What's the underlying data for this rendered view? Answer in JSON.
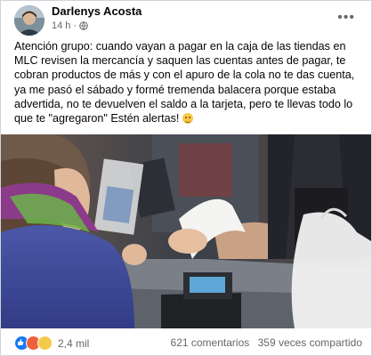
{
  "author": {
    "name": "Darlenys Acosta",
    "time": "14 h",
    "privacy_icon": "globe-icon"
  },
  "post": {
    "text": "Atención grupo: cuando vayan a pagar en la caja de las tiendas en MLC revisen la mercancía y saquen las cuentas antes de pagar, te cobran productos de más y con el apuro de la cola no te das cuenta, ya me pasó el sábado y formé tremenda balacera porque estaba advertida, no te devuelven el saldo a la tarjeta, pero te llevas todo lo que te \"agregaron\" Estén alertas!",
    "emoji": "grin-emoji"
  },
  "photo": {
    "description_icon": "photo"
  },
  "footer": {
    "reactions": [
      "like-icon",
      "angry-icon",
      "wow-icon"
    ],
    "reaction_count": "2,4 mil",
    "comments": "621 comentarios",
    "shares": "359 veces compartido"
  },
  "colors": {
    "link": "#1877f2",
    "secondary_text": "#65676b"
  }
}
